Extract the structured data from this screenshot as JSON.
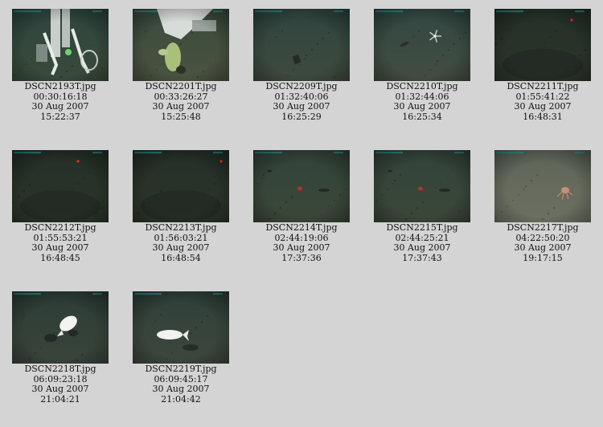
{
  "gallery": {
    "items": [
      {
        "filename": "DSCN2193T.jpg",
        "timecode": "00:30:16:18",
        "date": "30 Aug 2007",
        "time": "15:22:37",
        "scene": "rov-arm"
      },
      {
        "filename": "DSCN2201T.jpg",
        "timecode": "00:33:26:27",
        "date": "30 Aug 2007",
        "time": "15:25:48",
        "scene": "rov-sampler"
      },
      {
        "filename": "DSCN2209T.jpg",
        "timecode": "01:32:40:06",
        "date": "30 Aug 2007",
        "time": "16:25:29",
        "scene": "seafloor-object"
      },
      {
        "filename": "DSCN2210T.jpg",
        "timecode": "01:32:44:06",
        "date": "30 Aug 2007",
        "time": "16:25:34",
        "scene": "brittle-star"
      },
      {
        "filename": "DSCN2211T.jpg",
        "timecode": "01:55:41:22",
        "date": "30 Aug 2007",
        "time": "16:48:31",
        "scene": "dark-seafloor-laser"
      },
      {
        "filename": "DSCN2212T.jpg",
        "timecode": "01:55:53:21",
        "date": "30 Aug 2007",
        "time": "16:48:45",
        "scene": "dark-seafloor-laser"
      },
      {
        "filename": "DSCN2213T.jpg",
        "timecode": "01:56:03:21",
        "date": "30 Aug 2007",
        "time": "16:48:54",
        "scene": "dark-seafloor-laser"
      },
      {
        "filename": "DSCN2214T.jpg",
        "timecode": "02:44:19:06",
        "date": "30 Aug 2007",
        "time": "17:37:36",
        "scene": "seafloor-red-object"
      },
      {
        "filename": "DSCN2215T.jpg",
        "timecode": "02:44:25:21",
        "date": "30 Aug 2007",
        "time": "17:37:43",
        "scene": "seafloor-red-object"
      },
      {
        "filename": "DSCN2217T.jpg",
        "timecode": "04:22:50:20",
        "date": "30 Aug 2007",
        "time": "19:17:15",
        "scene": "octopus"
      },
      {
        "filename": "DSCN2218T.jpg",
        "timecode": "06:09:23:18",
        "date": "30 Aug 2007",
        "time": "21:04:21",
        "scene": "white-fish"
      },
      {
        "filename": "DSCN2219T.jpg",
        "timecode": "06:09:45:17",
        "date": "30 Aug 2007",
        "time": "21:04:42",
        "scene": "white-fish-side"
      }
    ]
  }
}
